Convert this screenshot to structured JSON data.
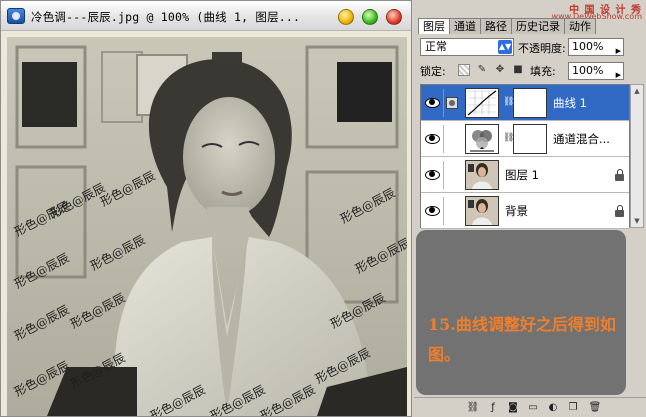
{
  "document": {
    "title": "冷色调---辰辰.jpg @ 100% (曲线 1, 图层..."
  },
  "watermark_text": "形色@辰辰",
  "panel": {
    "site_watermark": "中 国 设 计 秀",
    "site_watermark_sub": "www.DeWebShow.com",
    "tabs": [
      "图层",
      "通道",
      "路径",
      "历史记录",
      "动作"
    ],
    "blend_mode": "正常",
    "opacity_label": "不透明度:",
    "opacity_value": "100%",
    "lock_label": "锁定:",
    "fill_label": "填充:",
    "fill_value": "100%",
    "layers": [
      {
        "name": "曲线 1",
        "selected": true,
        "type": "adjustment"
      },
      {
        "name": "通道混合...",
        "selected": false,
        "type": "adjustment"
      },
      {
        "name": "图层 1",
        "selected": false,
        "type": "image"
      },
      {
        "name": "背景",
        "selected": false,
        "type": "image"
      }
    ],
    "note": "15.曲线调整好之后得到如图。"
  },
  "icons": {
    "lock_image": "brush-icon",
    "lock_position": "move-icon",
    "lock_all": "lock-icon",
    "bottom": [
      "link-icon",
      "fx-icon",
      "mask-icon",
      "folder-icon",
      "adjustment-icon",
      "new-layer-icon",
      "trash-icon"
    ]
  },
  "colors": {
    "selection": "#316ac5",
    "note_background": "#727272",
    "note_text": "#f07e2a"
  }
}
